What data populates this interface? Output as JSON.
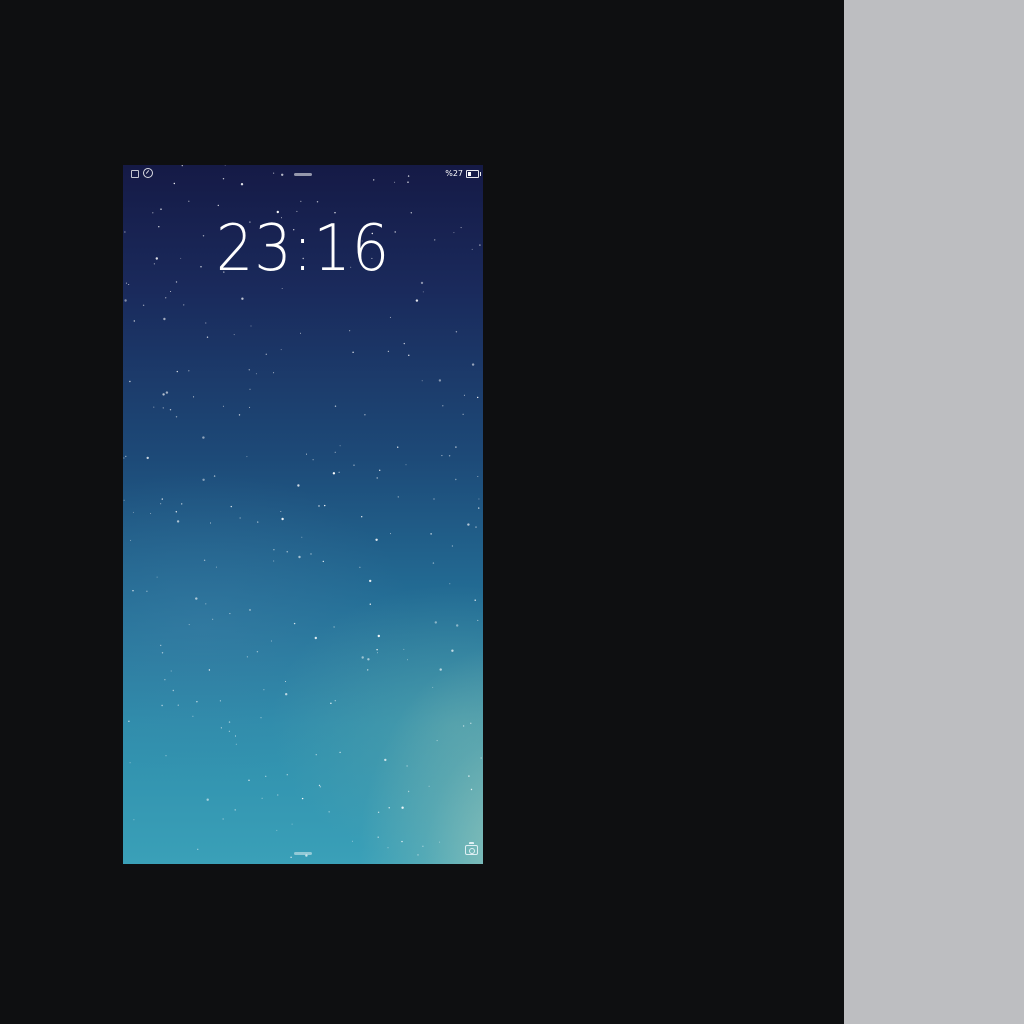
{
  "lock_screen": {
    "time": "23:16",
    "status_bar": {
      "battery_text": "%27",
      "left_icons": [
        "signal-icon",
        "alarm-clock-icon"
      ],
      "right_icons": [
        "battery-icon"
      ]
    },
    "camera_shortcut_icon": "camera-icon"
  },
  "colors": {
    "background": "#0e0f11",
    "side_panel": "#bdbec1",
    "sky_top": "#151a46",
    "sky_bottom": "#3aa0b8",
    "text": "#ffffff"
  }
}
